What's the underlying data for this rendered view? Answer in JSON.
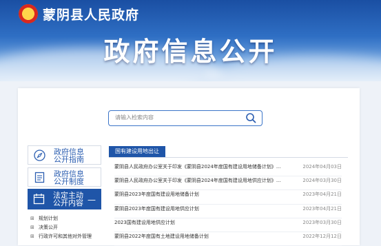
{
  "header": {
    "gov_name": "蒙阴县人民政府",
    "main_title": "政府信息公开"
  },
  "search": {
    "placeholder": "请输入检索内容",
    "icon": "search-icon"
  },
  "sidebar": {
    "items": [
      {
        "label_line1": "政府信息",
        "label_line2": "公开指南",
        "icon": "compass-icon"
      },
      {
        "label_line1": "政府信息",
        "label_line2": "公开制度",
        "icon": "document-icon"
      },
      {
        "label_line1": "法定主动",
        "label_line2": "公开内容",
        "icon": "calendar-icon",
        "active": true,
        "toggle": "—"
      }
    ],
    "tree": [
      {
        "label": "规划计划"
      },
      {
        "label": "决策公开"
      },
      {
        "label": "行政许可和其他对外管理"
      }
    ]
  },
  "main": {
    "tab_label": "国有建设用地出让",
    "rows": [
      {
        "title": "蒙阴县人民政府办公室关于印发《蒙阴县2024年度国有建设用地储备计划》...",
        "date": "2024年04月03日"
      },
      {
        "title": "蒙阴县人民政府办公室关于印发《蒙阴县2024年度国有建设用地供应计划》...",
        "date": "2024年03月30日"
      },
      {
        "title": "蒙阴县2023年度国有建设用地储备计划",
        "date": "2023年04月21日"
      },
      {
        "title": "蒙阴县2023年度国有建设用地供应计划",
        "date": "2023年04月21日"
      },
      {
        "title": "2023国有建设用地供应计划",
        "date": "2023年03月30日"
      },
      {
        "title": "蒙阴县2022年度国有土地建设用地储备计划",
        "date": "2022年12月12日"
      }
    ]
  },
  "colors": {
    "primary": "#1f55a8",
    "link": "#2a5db0",
    "banner_top": "#1a4fa3"
  }
}
